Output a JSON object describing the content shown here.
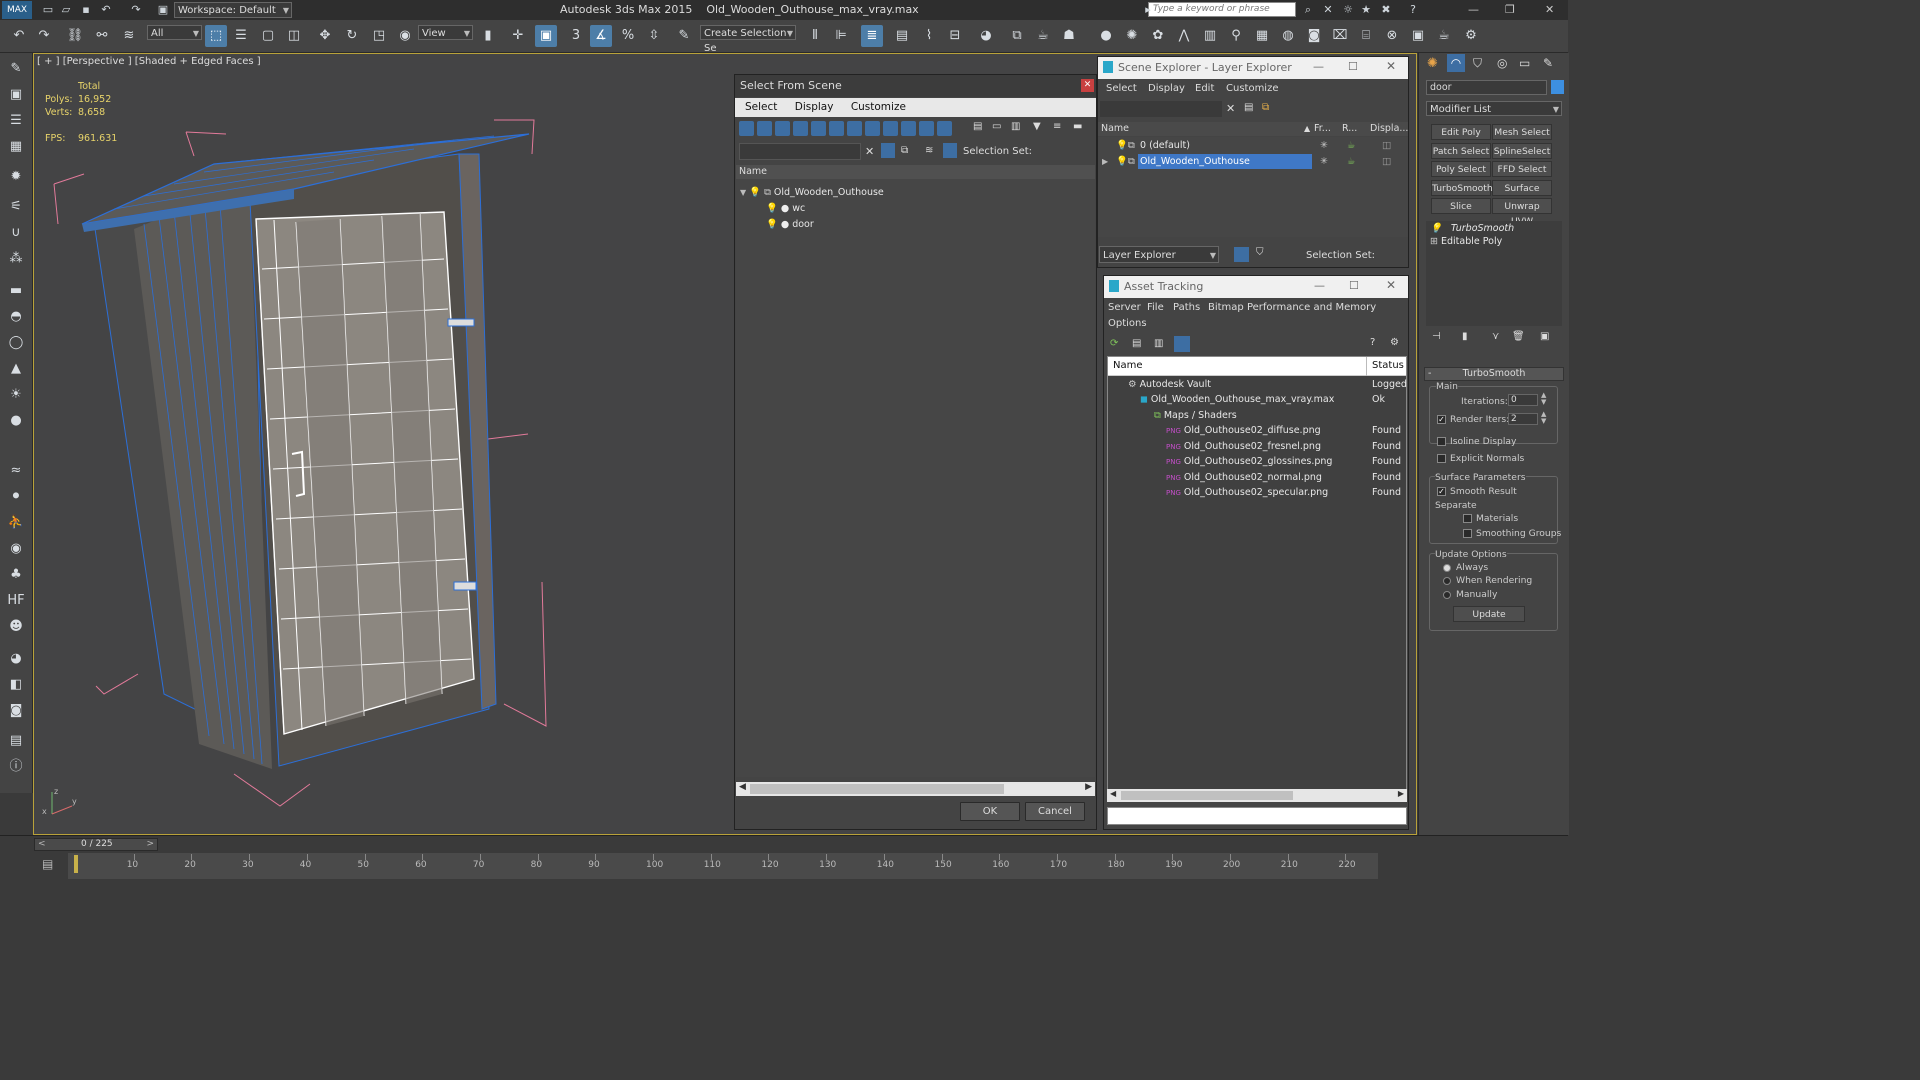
{
  "app": {
    "title": "Autodesk 3ds Max  2015",
    "file": "Old_Wooden_Outhouse_max_vray.max",
    "workspace": "Workspace: Default",
    "search_placeholder": "Type a keyword or phrase"
  },
  "toolbar": {
    "filter": "All",
    "view": "View",
    "create_selection": "Create Selection Se"
  },
  "viewport": {
    "label": "[ + ] [Perspective ] [Shaded + Edged Faces ]",
    "stats": {
      "total_label": "Total",
      "polys_label": "Polys:",
      "polys": "16,952",
      "verts_label": "Verts:",
      "verts": "8,658",
      "fps_label": "FPS:",
      "fps": "961.631"
    }
  },
  "select_from_scene": {
    "title": "Select From Scene",
    "menu": [
      "Select",
      "Display",
      "Customize"
    ],
    "selection_set": "Selection Set:",
    "column": "Name",
    "items": [
      {
        "name": "Old_Wooden_Outhouse",
        "level": 0
      },
      {
        "name": "wc",
        "level": 1
      },
      {
        "name": "door",
        "level": 1
      }
    ],
    "ok": "OK",
    "cancel": "Cancel"
  },
  "scene_explorer": {
    "title": "Scene Explorer - Layer Explorer",
    "menu": [
      "Select",
      "Display",
      "Edit",
      "Customize"
    ],
    "columns": [
      "Name",
      "Fr...",
      "R...",
      "Displa..."
    ],
    "layers": [
      "0 (default)",
      "Old_Wooden_Outhouse"
    ],
    "footer_combo": "Layer Explorer",
    "selection_set": "Selection Set:"
  },
  "asset_tracking": {
    "title": "Asset Tracking",
    "menu": [
      "Server",
      "File",
      "Paths",
      "Bitmap Performance and Memory",
      "Options"
    ],
    "columns": [
      "Name",
      "Status"
    ],
    "rows": [
      {
        "name": "Autodesk Vault",
        "status": "Logged"
      },
      {
        "name": "Old_Wooden_Outhouse_max_vray.max",
        "status": "Ok"
      },
      {
        "name": "Maps / Shaders",
        "status": ""
      },
      {
        "name": "Old_Outhouse02_diffuse.png",
        "status": "Found"
      },
      {
        "name": "Old_Outhouse02_fresnel.png",
        "status": "Found"
      },
      {
        "name": "Old_Outhouse02_glossines.png",
        "status": "Found"
      },
      {
        "name": "Old_Outhouse02_normal.png",
        "status": "Found"
      },
      {
        "name": "Old_Outhouse02_specular.png",
        "status": "Found"
      }
    ]
  },
  "command_panel": {
    "object_name": "door",
    "modifier_list": "Modifier List",
    "buttons": [
      "Edit Poly",
      "Mesh Select",
      "Patch Select",
      "SplineSelect",
      "Poly Select",
      "FFD Select",
      "TurboSmooth",
      "Surface Select",
      "Slice",
      "Unwrap UVW"
    ],
    "stack": [
      "TurboSmooth",
      "Editable Poly"
    ],
    "rollout_title": "TurboSmooth",
    "main_label": "Main",
    "iterations_label": "Iterations:",
    "iterations": "0",
    "render_iters_label": "Render Iters:",
    "render_iters": "2",
    "isoline": "Isoline Display",
    "explicit_normals": "Explicit Normals",
    "surface_params": "Surface Parameters",
    "smooth_result": "Smooth Result",
    "separate": "Separate",
    "materials": "Materials",
    "smoothing_groups": "Smoothing Groups",
    "update_options": "Update Options",
    "always": "Always",
    "when_rendering": "When Rendering",
    "manually": "Manually",
    "update": "Update"
  },
  "timeline": {
    "frame": "0 / 225",
    "ticks": [
      "10",
      "20",
      "30",
      "40",
      "50",
      "60",
      "70",
      "80",
      "90",
      "100",
      "110",
      "120",
      "130",
      "140",
      "150",
      "160",
      "170",
      "180",
      "190",
      "200",
      "210",
      "220"
    ]
  }
}
